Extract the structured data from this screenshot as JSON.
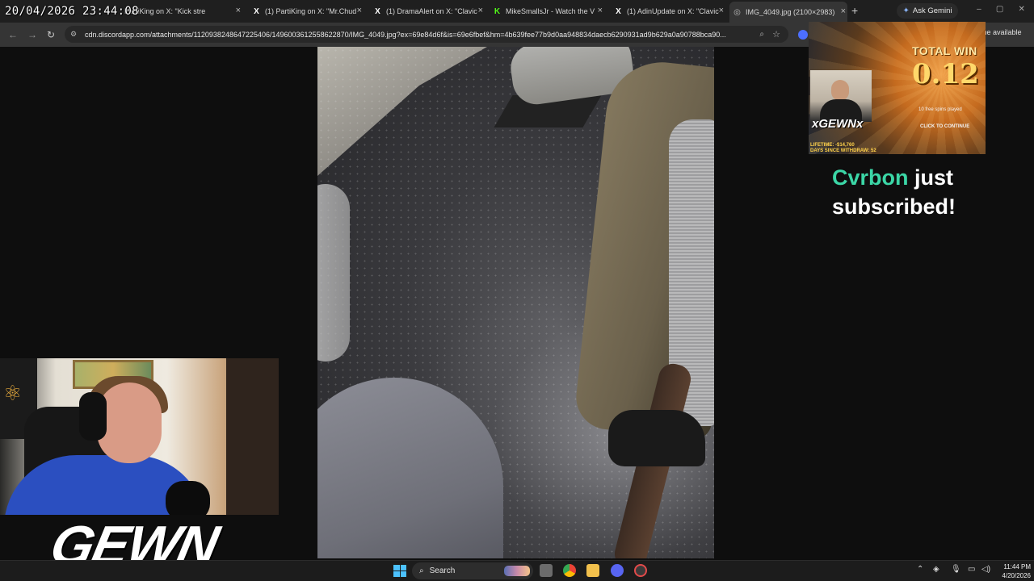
{
  "overlay": {
    "timestamp": "20/04/2026 23:44:08"
  },
  "browser": {
    "tabs": [
      {
        "title": "PartiKing on X: \"Kick stre",
        "favicon": "x-logo-icon"
      },
      {
        "title": "(1) PartiKing on X: \"Mr.Chud",
        "favicon": "x-logo-icon"
      },
      {
        "title": "(1) DramaAlert on X: \"Clavic",
        "favicon": "x-logo-icon"
      },
      {
        "title": "MikeSmallsJr - Watch the V",
        "favicon": "kick-logo-icon"
      },
      {
        "title": "(1) AdinUpdate on X: \"Clavic",
        "favicon": "x-logo-icon"
      },
      {
        "title": "IMG_4049.jpg (2100×2983)",
        "favicon": "globe-icon"
      }
    ],
    "gemini_label": "Ask Gemini",
    "url": "cdn.discordapp.com/attachments/1120938248647225406/1496003612558622870/IMG_4049.jpg?ex=69e84d6f&is=69e6fbef&hm=4b639fee77b9d0aa948834daecb6290931ad9b629a0a90788bca90...",
    "update_text": "me available"
  },
  "stream": {
    "slot": {
      "total_win_label": "TOTAL WIN",
      "total_win_value": "0.12",
      "spins_text": "10 free spins played",
      "continue_text": "CLICK TO CONTINUE",
      "brand": "xGEWNx",
      "lifetime": "LIFETIME: -$14,760",
      "days_since": "DAYS SINCE WITHDRAW: 52"
    },
    "alert": {
      "name": "Cvrbon",
      "text1": " just",
      "text2": "subscribed!"
    },
    "logo": "GEWN"
  },
  "taskbar": {
    "search_label": "Search",
    "time": "11:44 PM",
    "date": "4/20/2026"
  }
}
